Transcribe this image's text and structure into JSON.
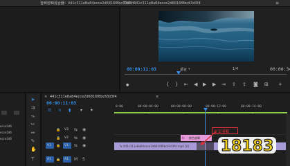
{
  "tabs": {
    "audio_mixer": "音频剪辑混合器：441c311e8a84ecce2d6816f8bc63d3f4",
    "program": "节目：441c311e8a84ecce2d6816f8bc63d3f4"
  },
  "monitor": {
    "timecode_current": "00:00:11:03",
    "fit_label": "适合",
    "resolution": "1/4",
    "timecode_end": "00:00:34:2"
  },
  "timeline": {
    "sequence_name": "441c311e8a84ecce2d6816f8bc63d3f4",
    "timecode": "00:00:11:03",
    "ruler_ticks": [
      "0:00",
      "00:00:04:00",
      "00:00:08:00",
      "00:00:12:00",
      "00:00:16:00"
    ],
    "tracks": [
      {
        "name": "V3",
        "target": ""
      },
      {
        "name": "V2",
        "target": ""
      },
      {
        "name": "V1",
        "target": "V1"
      },
      {
        "name": "A1",
        "target": "A1"
      }
    ],
    "clip_pink_label": "颜色遮罩",
    "clip_v1_label": "fx 441c311e8a84ecce2d6816f8bc63d3f4.mp4 [V]",
    "callout_label": "交叉溶解"
  },
  "project": {
    "file_items": [
      "ecce2d6",
      "ecce2d6",
      "ecce2d6"
    ]
  },
  "watermark": "18183",
  "colors": {
    "accent_blue": "#3a8fe8",
    "clip_purple": "#a79ad8",
    "clip_pink": "#e79ad9",
    "callout_red": "#e0303a",
    "watermark_yellow": "#f5d21a"
  },
  "icons": [
    "selection-tool-icon",
    "track-select-tool-icon",
    "ripple-edit-tool-icon",
    "razor-tool-icon",
    "slip-tool-icon",
    "pen-tool-icon",
    "hand-tool-icon",
    "type-tool-icon",
    "play-button-icon",
    "step-back-icon",
    "step-forward-icon",
    "eye-icon",
    "lock-icon",
    "camera-icon"
  ]
}
